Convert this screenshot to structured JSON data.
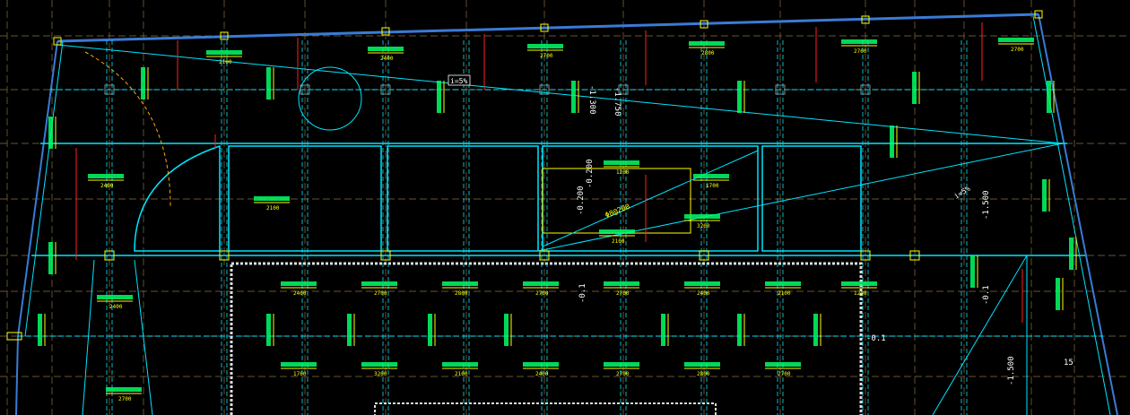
{
  "colors": {
    "background": "#000000",
    "grid": "#8a7040",
    "structure": "#00e5ff",
    "frame": "#3a7bd5",
    "rebar_text": "#00ff66",
    "dimension": "#ffff00",
    "red_line": "#ff2020",
    "white_line": "#dddddd"
  },
  "labels": {
    "elev_top_1": "-1.300",
    "elev_top_2": "-1.750",
    "elev_mid_1": "-0.200",
    "elev_mid_2": "-0.200",
    "elev_right_1": "-1.500",
    "elev_bottom_right": "-1.500",
    "elev_small_1": "-0.1",
    "elev_small_2": "-0.1",
    "elev_small_3": "-0.1",
    "elev_small_4": "15",
    "slope_tag_1": "i=5%",
    "slope_tag_2": "i=5%",
    "rebar_callout": "Φ8@200"
  },
  "dimension_texts": [
    "2100",
    "2400",
    "2700",
    "2800",
    "2700",
    "2700",
    "2400",
    "2100",
    "1200",
    "1700",
    "3200"
  ]
}
